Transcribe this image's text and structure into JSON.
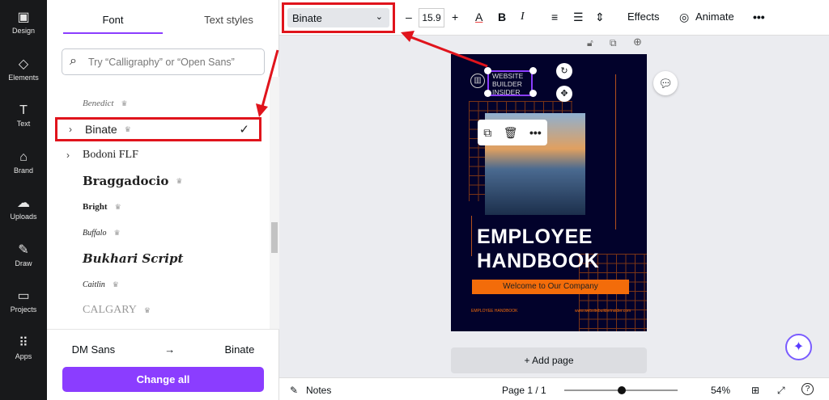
{
  "rail": [
    {
      "icon": "design-icon",
      "glyph": "▣",
      "label": "Design"
    },
    {
      "icon": "elements-icon",
      "glyph": "◇",
      "label": "Elements"
    },
    {
      "icon": "text-icon",
      "glyph": "T",
      "label": "Text"
    },
    {
      "icon": "brand-icon",
      "glyph": "⌂",
      "label": "Brand"
    },
    {
      "icon": "uploads-icon",
      "glyph": "☁",
      "label": "Uploads"
    },
    {
      "icon": "draw-icon",
      "glyph": "✎",
      "label": "Draw"
    },
    {
      "icon": "projects-icon",
      "glyph": "▭",
      "label": "Projects"
    },
    {
      "icon": "apps-icon",
      "glyph": "⠿",
      "label": "Apps"
    }
  ],
  "panel": {
    "tabs": [
      "Font",
      "Text styles"
    ],
    "search_placeholder": "Try “Calligraphy” or “Open Sans”",
    "fonts": [
      {
        "name": "Benedict",
        "crown": true
      },
      {
        "name": "Binate",
        "crown": true,
        "selected": true,
        "expand": true
      },
      {
        "name": "Bodoni FLF",
        "expand": true
      },
      {
        "name": "Braggadocio",
        "crown": true
      },
      {
        "name": "Bright",
        "crown": true
      },
      {
        "name": "Buffalo",
        "crown": true
      },
      {
        "name": "Bukhari Script"
      },
      {
        "name": "Caitlin",
        "crown": true
      },
      {
        "name": "CALGARY",
        "crown": true
      }
    ],
    "from_font": "DM Sans",
    "to_font": "Binate",
    "change_all": "Change all"
  },
  "toolbar": {
    "font": "Binate",
    "minus": "–",
    "size": "15.9",
    "plus": "+",
    "effects": "Effects",
    "animate": "Animate"
  },
  "design": {
    "logo_lines": [
      "WEBSITE",
      "BUILDER",
      "INSIDER"
    ],
    "title_lines": [
      "EMPLOYEE",
      "HANDBOOK"
    ],
    "subtitle": "Welcome to Our Company",
    "footer_left": "EMPLOYEE HANDBOOK",
    "footer_right": "www.websitebuilderinsider.com"
  },
  "canvas": {
    "add_page": "+ Add page"
  },
  "bottom": {
    "notes": "Notes",
    "page": "Page 1 / 1",
    "zoom": "54%",
    "zoom_fraction": 0.54,
    "help": "?"
  }
}
